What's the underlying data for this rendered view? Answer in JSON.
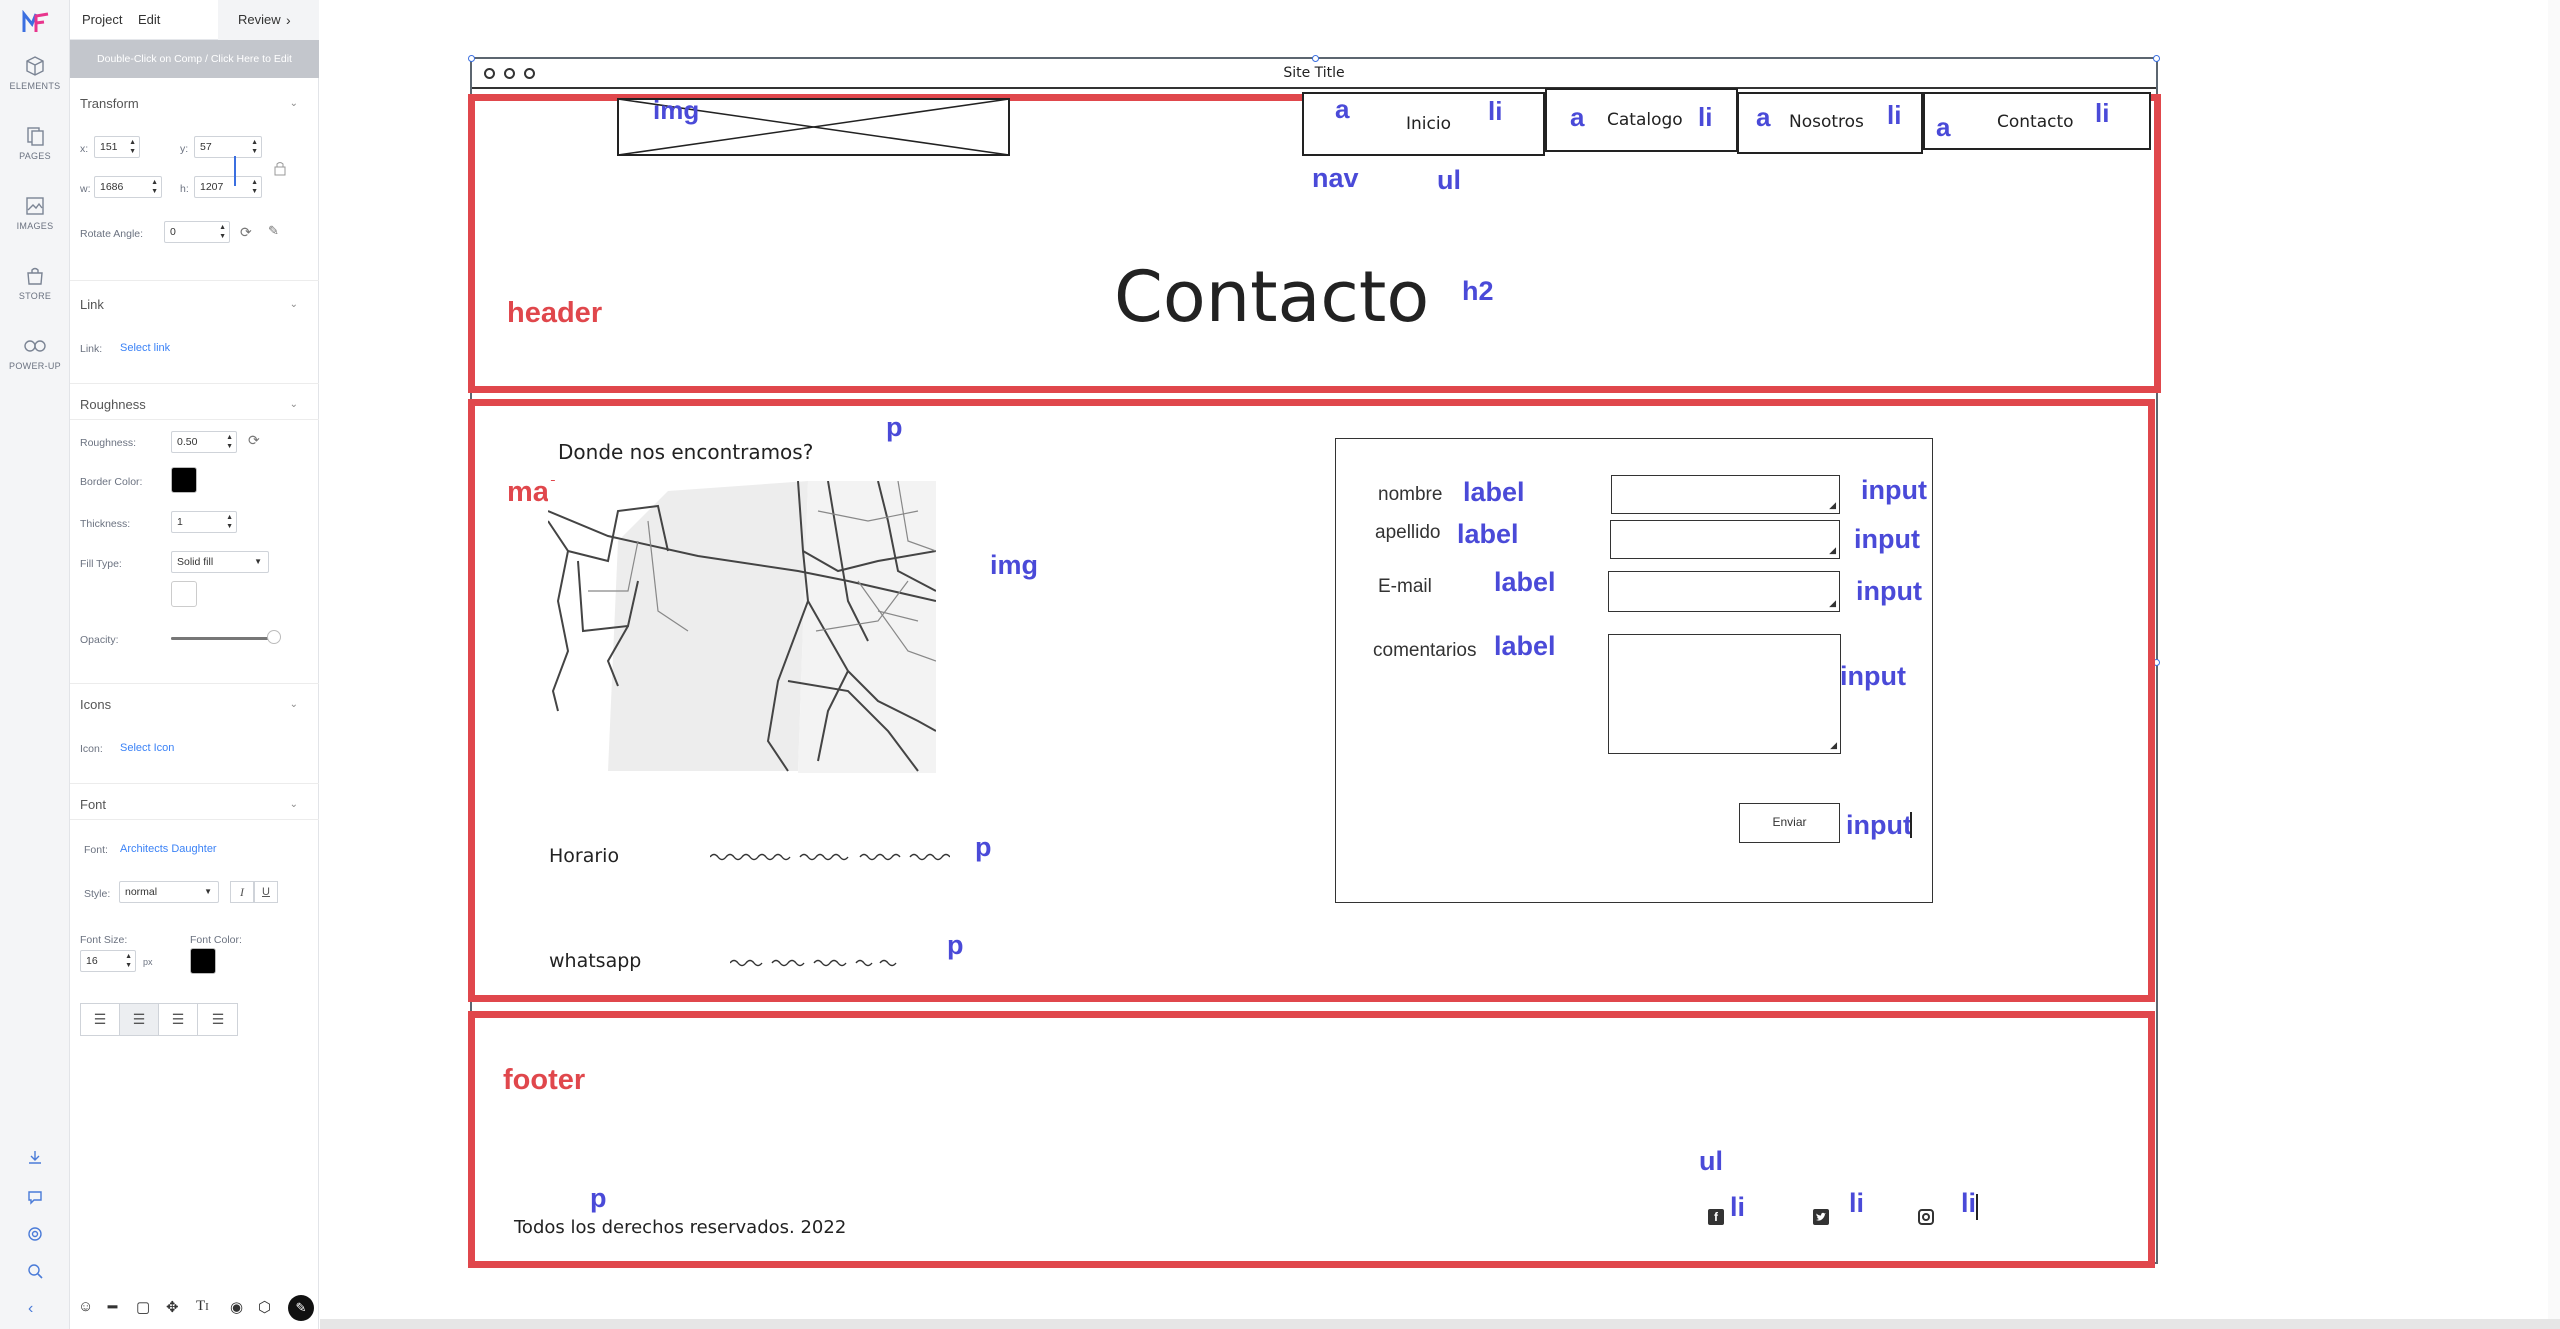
{
  "rail": {
    "items": [
      {
        "label": "ELEMENTS",
        "icon": "cube-icon"
      },
      {
        "label": "PAGES",
        "icon": "pages-icon"
      },
      {
        "label": "IMAGES",
        "icon": "image-icon"
      },
      {
        "label": "STORE",
        "icon": "bag-icon"
      },
      {
        "label": "POWER-UP",
        "icon": "infinity-icon"
      }
    ]
  },
  "menu": {
    "project": "Project",
    "edit": "Edit",
    "review": "Review"
  },
  "hint": "Double-Click on Comp / Click Here to Edit",
  "transform": {
    "title": "Transform",
    "x_label": "x:",
    "x": "151",
    "y_label": "y:",
    "y": "57",
    "w_label": "w:",
    "w": "1686",
    "h_label": "h:",
    "h": "1207",
    "rotate_label": "Rotate Angle:",
    "rotate": "0"
  },
  "link": {
    "title": "Link",
    "label": "Link:",
    "value": "Select link"
  },
  "roughness": {
    "title": "Roughness",
    "roughness_label": "Roughness:",
    "roughness": "0.50",
    "border_color_label": "Border Color:",
    "thickness_label": "Thickness:",
    "thickness": "1",
    "fill_type_label": "Fill Type:",
    "fill_type": "Solid fill",
    "opacity_label": "Opacity:",
    "opacity": 0.95
  },
  "icons": {
    "title": "Icons",
    "label": "Icon:",
    "value": "Select Icon"
  },
  "font": {
    "title": "Font",
    "font_label": "Font:",
    "font_value": "Architects Daughter",
    "style_label": "Style:",
    "style_value": "normal",
    "italic": "I",
    "underline": "U",
    "size_label": "Font Size:",
    "size": "16",
    "size_unit": "px",
    "color_label": "Font Color:"
  },
  "colors": {
    "border": "#000000",
    "font": "#000000",
    "accent_red": "#e0474c",
    "annot_blue": "#4a4ad8",
    "link": "#3b82f6"
  },
  "wireframe": {
    "site_title": "Site Title",
    "nav": {
      "tabs": [
        "Inicio",
        "Catalogo",
        "Nosotros",
        "Contacto"
      ],
      "a": "a",
      "li": "li"
    },
    "heading": "Contacto",
    "main": {
      "where": "Donde nos encontramos?",
      "horario": "Horario",
      "whatsapp": "whatsapp",
      "form_labels": [
        "nombre",
        "apellido",
        "E-mail",
        "comentarios"
      ],
      "submit": "Enviar"
    },
    "footer": {
      "copyright": "Todos los derechos reservados. 2022"
    }
  },
  "annotations": {
    "img": "img",
    "nav": "nav",
    "ul": "ul",
    "h2": "h2",
    "header": "header",
    "main": "main",
    "footer": "footer",
    "p": "p",
    "label": "label",
    "input": "input",
    "li": "li",
    "a": "a"
  }
}
